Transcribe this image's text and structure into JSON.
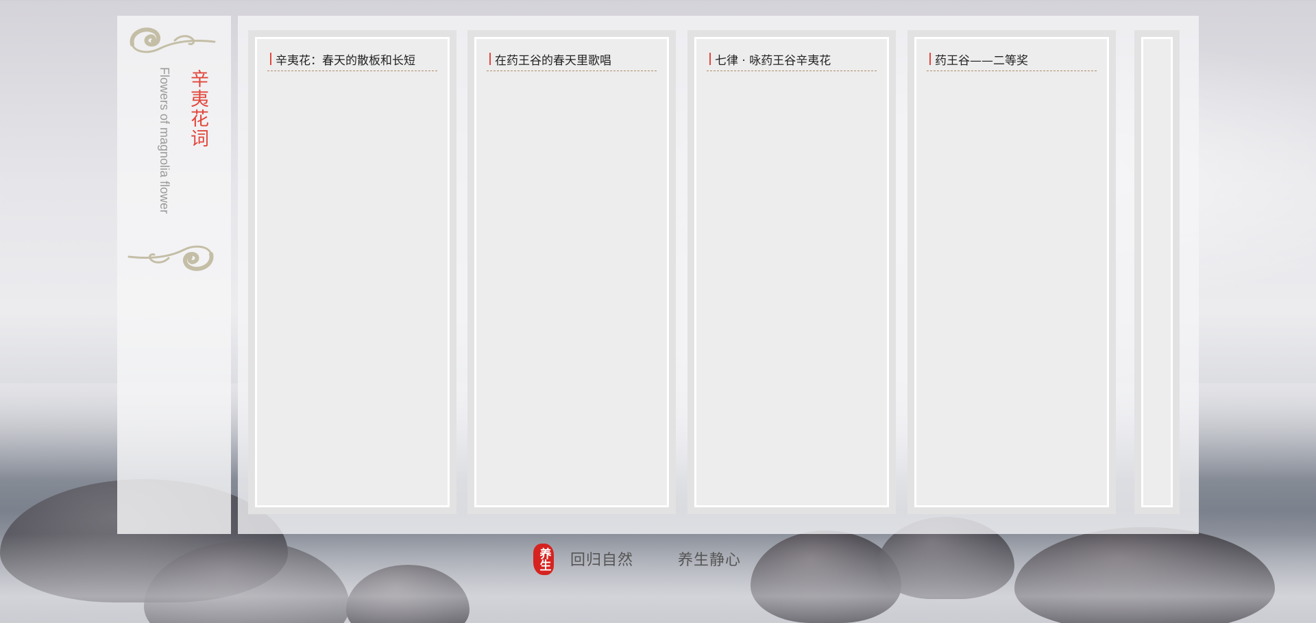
{
  "sidebar": {
    "cn_title": "辛夷花词",
    "en_title": "Flowers of magnolia flower"
  },
  "cards": [
    {
      "title": "辛夷花：春天的散板和长短"
    },
    {
      "title": "在药王谷的春天里歌唱"
    },
    {
      "title": "七律 · 咏药王谷辛夷花"
    },
    {
      "title": "药王谷——二等奖"
    },
    {
      "title": ""
    }
  ],
  "footer": {
    "seal": "养生",
    "link1": "回归自然",
    "link2": "养生静心"
  },
  "colors": {
    "accent": "#e2463b",
    "seal": "#d6231f",
    "cloud": "#c4bea6",
    "divider": "#b08a66"
  }
}
